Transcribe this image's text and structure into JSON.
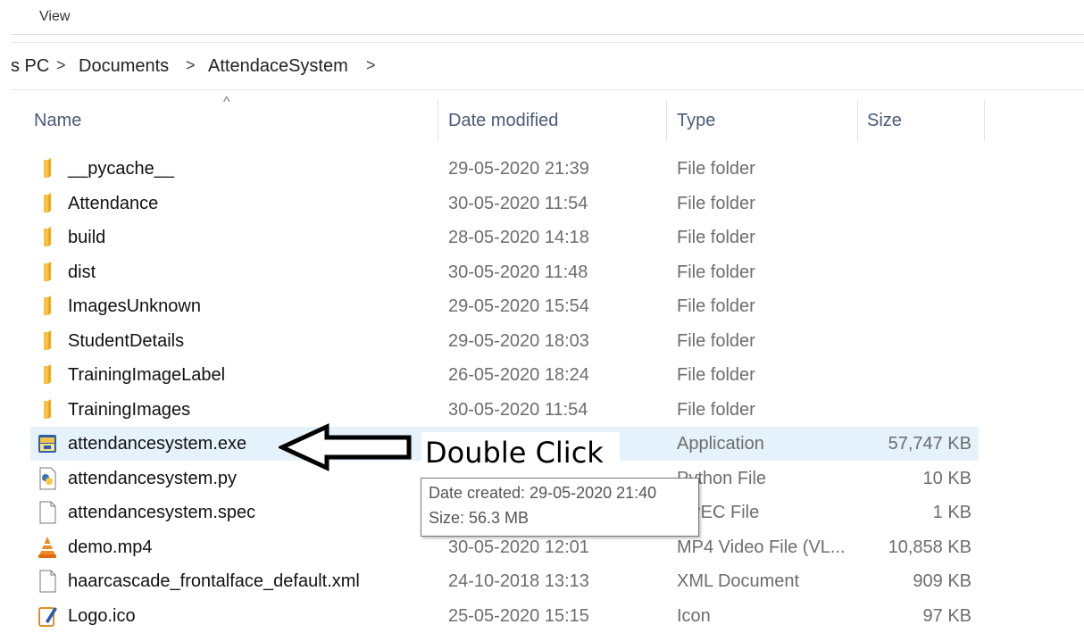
{
  "ribbon": {
    "view_tab": "View"
  },
  "breadcrumb": {
    "items": [
      "s PC",
      "Documents",
      "AttendaceSystem"
    ],
    "separator": ">"
  },
  "columns": {
    "name": "Name",
    "date_modified": "Date modified",
    "type": "Type",
    "size": "Size",
    "sort_caret": "^"
  },
  "files": [
    {
      "name": "__pycache__",
      "date": "29-05-2020 21:39",
      "type": "File folder",
      "size": "",
      "icon": "folder-icon"
    },
    {
      "name": "Attendance",
      "date": "30-05-2020 11:54",
      "type": "File folder",
      "size": "",
      "icon": "folder-icon"
    },
    {
      "name": "build",
      "date": "28-05-2020 14:18",
      "type": "File folder",
      "size": "",
      "icon": "folder-icon"
    },
    {
      "name": "dist",
      "date": "30-05-2020 11:48",
      "type": "File folder",
      "size": "",
      "icon": "folder-icon"
    },
    {
      "name": "ImagesUnknown",
      "date": "29-05-2020 15:54",
      "type": "File folder",
      "size": "",
      "icon": "folder-icon"
    },
    {
      "name": "StudentDetails",
      "date": "29-05-2020 18:03",
      "type": "File folder",
      "size": "",
      "icon": "folder-icon"
    },
    {
      "name": "TrainingImageLabel",
      "date": "26-05-2020 18:24",
      "type": "File folder",
      "size": "",
      "icon": "folder-icon"
    },
    {
      "name": "TrainingImages",
      "date": "30-05-2020 11:54",
      "type": "File folder",
      "size": "",
      "icon": "folder-icon"
    },
    {
      "name": "attendancesystem.exe",
      "date": "",
      "type": "Application",
      "size": "57,747 KB",
      "icon": "application-icon",
      "selected": true
    },
    {
      "name": "attendancesystem.py",
      "date": "",
      "type": "Python File",
      "size": "10 KB",
      "icon": "python-file-icon"
    },
    {
      "name": "attendancesystem.spec",
      "date": "",
      "type": "SPEC File",
      "size": "1 KB",
      "icon": "document-icon"
    },
    {
      "name": "demo.mp4",
      "date": "30-05-2020 12:01",
      "type": "MP4 Video File (VL...",
      "size": "10,858 KB",
      "icon": "vlc-icon"
    },
    {
      "name": "haarcascade_frontalface_default.xml",
      "date": "24-10-2018 13:13",
      "type": "XML Document",
      "size": "909 KB",
      "icon": "document-icon"
    },
    {
      "name": "Logo.ico",
      "date": "25-05-2020 15:15",
      "type": "Icon",
      "size": "97 KB",
      "icon": "image-edit-icon"
    }
  ],
  "annotation": {
    "text": "Double Click"
  },
  "tooltip": {
    "date_created": "Date created: 29-05-2020 21:40",
    "size": "Size: 56.3 MB"
  },
  "colors": {
    "selection": "#e5f1fb",
    "folder": "#f2c14e",
    "header_text": "#4a5a78"
  }
}
